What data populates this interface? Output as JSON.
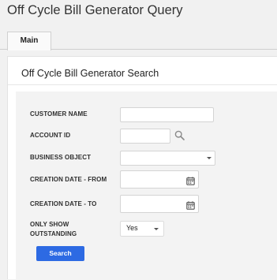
{
  "page": {
    "title": "Off Cycle Bill Generator Query"
  },
  "tabs": [
    {
      "label": "Main"
    }
  ],
  "section": {
    "title": "Off Cycle Bill Generator Search"
  },
  "form": {
    "customer_name": {
      "label": "CUSTOMER NAME",
      "value": ""
    },
    "account_id": {
      "label": "ACCOUNT ID",
      "value": ""
    },
    "business_object": {
      "label": "BUSINESS OBJECT",
      "value": ""
    },
    "creation_date_from": {
      "label": "CREATION DATE - FROM",
      "value": ""
    },
    "creation_date_to": {
      "label": "CREATION DATE - TO",
      "value": ""
    },
    "only_show_outstanding": {
      "label_line1": "ONLY SHOW",
      "label_line2": "OUTSTANDING",
      "value": "Yes"
    },
    "search_label": "Search"
  },
  "icons": {
    "account_search": "search-icon",
    "date_from": "calendar-icon",
    "date_to": "calendar-icon"
  },
  "colors": {
    "primary_button": "#2d6ae3"
  }
}
